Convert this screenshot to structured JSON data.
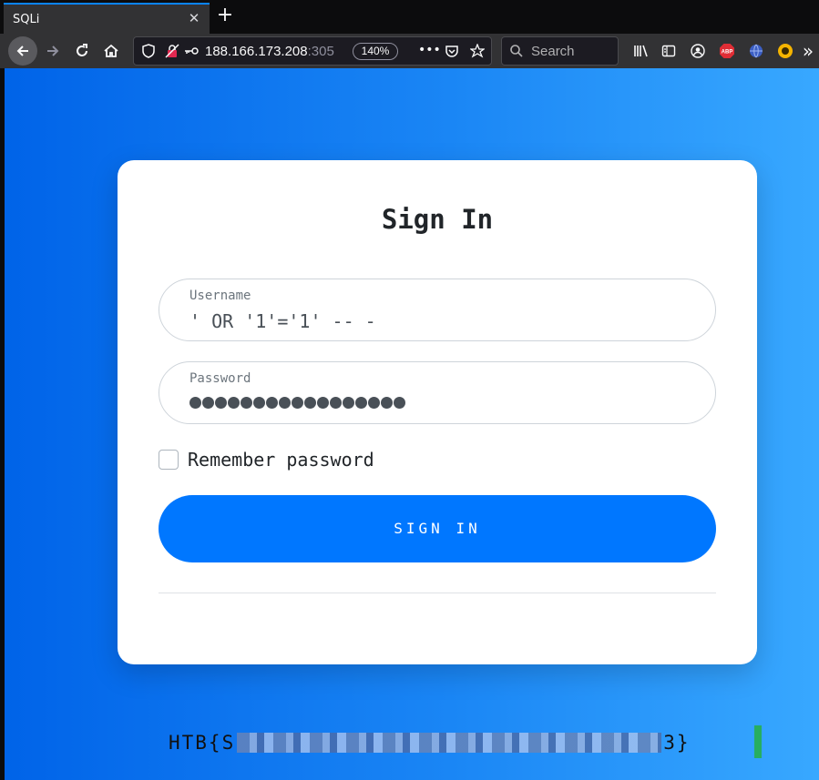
{
  "browser": {
    "tab_title": "SQLi",
    "tab_close": "✕",
    "new_tab": "+",
    "url_host": "188.166.173.208",
    "url_port": ":305",
    "zoom": "140%",
    "search_placeholder": "Search",
    "more_menu": "•••",
    "overflow": "»",
    "abp_label": "ABP"
  },
  "login": {
    "title": "Sign In",
    "username_label": "Username",
    "username_value": "' OR '1'='1' -- -",
    "password_label": "Password",
    "password_length": 17,
    "remember_label": "Remember password",
    "remember_checked": false,
    "signin_label": "SIGN IN"
  },
  "flag": {
    "prefix": "HTB{S",
    "suffix": "3}"
  },
  "colors": {
    "accent": "#0077ff",
    "gradient_start": "#0063e8",
    "gradient_end": "#38a8ff",
    "tab_highlight": "#0a84ff"
  }
}
